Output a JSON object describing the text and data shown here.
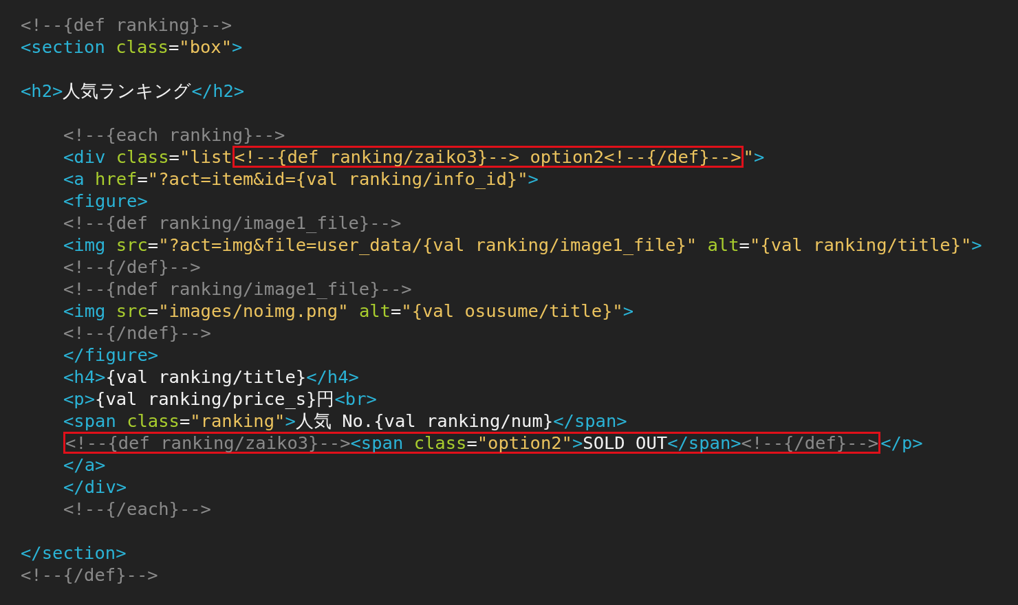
{
  "editor": {
    "sections": [
      {
        "lines": [
          {
            "parts": [
              {
                "boxed": false,
                "tokens": [
                  {
                    "kind": "comment",
                    "text": "<!--{def ranking}-->"
                  }
                ]
              }
            ]
          },
          {
            "parts": [
              {
                "boxed": false,
                "tokens": [
                  {
                    "kind": "tag",
                    "text": "<section "
                  },
                  {
                    "kind": "attr",
                    "text": "class"
                  },
                  {
                    "kind": "plain",
                    "text": "="
                  },
                  {
                    "kind": "string",
                    "text": "\"box\""
                  },
                  {
                    "kind": "tag",
                    "text": ">"
                  }
                ]
              }
            ]
          }
        ]
      },
      {
        "lines": [
          {
            "parts": [
              {
                "boxed": false,
                "tokens": [
                  {
                    "kind": "tag",
                    "text": "<h2>"
                  },
                  {
                    "kind": "plain",
                    "text": "人気ランキング"
                  },
                  {
                    "kind": "tag",
                    "text": "</h2>"
                  }
                ]
              }
            ]
          }
        ],
        "children": [
          {
            "lines": [
              {
                "parts": [
                  {
                    "boxed": false,
                    "tokens": [
                      {
                        "kind": "comment",
                        "text": "<!--{each ranking}-->"
                      }
                    ]
                  }
                ]
              },
              {
                "parts": [
                  {
                    "boxed": false,
                    "tokens": [
                      {
                        "kind": "tag",
                        "text": "<div "
                      },
                      {
                        "kind": "attr",
                        "text": "class"
                      },
                      {
                        "kind": "plain",
                        "text": "="
                      },
                      {
                        "kind": "string",
                        "text": "\"list"
                      }
                    ]
                  },
                  {
                    "boxed": true,
                    "tokens": [
                      {
                        "kind": "string",
                        "text": "<!--{def ranking/zaiko3}--> option2<!--{/def}-->"
                      }
                    ]
                  },
                  {
                    "boxed": false,
                    "tokens": [
                      {
                        "kind": "string",
                        "text": "\""
                      },
                      {
                        "kind": "tag",
                        "text": ">"
                      }
                    ]
                  }
                ]
              },
              {
                "parts": [
                  {
                    "boxed": false,
                    "tokens": [
                      {
                        "kind": "tag",
                        "text": "<a "
                      },
                      {
                        "kind": "attr",
                        "text": "href"
                      },
                      {
                        "kind": "plain",
                        "text": "="
                      },
                      {
                        "kind": "string",
                        "text": "\"?act=item&id={val ranking/info_id}\""
                      },
                      {
                        "kind": "tag",
                        "text": ">"
                      }
                    ]
                  }
                ]
              },
              {
                "parts": [
                  {
                    "boxed": false,
                    "tokens": [
                      {
                        "kind": "tag",
                        "text": "<figure>"
                      }
                    ]
                  }
                ]
              },
              {
                "parts": [
                  {
                    "boxed": false,
                    "tokens": [
                      {
                        "kind": "comment",
                        "text": "<!--{def ranking/image1_file}-->"
                      }
                    ]
                  }
                ]
              },
              {
                "parts": [
                  {
                    "boxed": false,
                    "tokens": [
                      {
                        "kind": "tag",
                        "text": "<img "
                      },
                      {
                        "kind": "attr",
                        "text": "src"
                      },
                      {
                        "kind": "plain",
                        "text": "="
                      },
                      {
                        "kind": "string",
                        "text": "\"?act=img&file=user_data/{val ranking/image1_file}\" "
                      },
                      {
                        "kind": "attr",
                        "text": "alt"
                      },
                      {
                        "kind": "plain",
                        "text": "="
                      },
                      {
                        "kind": "string",
                        "text": "\"{val ranking/title}\""
                      },
                      {
                        "kind": "tag",
                        "text": ">"
                      }
                    ]
                  }
                ]
              },
              {
                "parts": [
                  {
                    "boxed": false,
                    "tokens": [
                      {
                        "kind": "comment",
                        "text": "<!--{/def}-->"
                      }
                    ]
                  }
                ]
              },
              {
                "parts": [
                  {
                    "boxed": false,
                    "tokens": [
                      {
                        "kind": "comment",
                        "text": "<!--{ndef ranking/image1_file}-->"
                      }
                    ]
                  }
                ]
              },
              {
                "parts": [
                  {
                    "boxed": false,
                    "tokens": [
                      {
                        "kind": "tag",
                        "text": "<img "
                      },
                      {
                        "kind": "attr",
                        "text": "src"
                      },
                      {
                        "kind": "plain",
                        "text": "="
                      },
                      {
                        "kind": "string",
                        "text": "\"images/noimg.png\" "
                      },
                      {
                        "kind": "attr",
                        "text": "alt"
                      },
                      {
                        "kind": "plain",
                        "text": "="
                      },
                      {
                        "kind": "string",
                        "text": "\"{val osusume/title}\""
                      },
                      {
                        "kind": "tag",
                        "text": ">"
                      }
                    ]
                  }
                ]
              },
              {
                "parts": [
                  {
                    "boxed": false,
                    "tokens": [
                      {
                        "kind": "comment",
                        "text": "<!--{/ndef}-->"
                      }
                    ]
                  }
                ]
              },
              {
                "parts": [
                  {
                    "boxed": false,
                    "tokens": [
                      {
                        "kind": "tag",
                        "text": "</figure>"
                      }
                    ]
                  }
                ]
              },
              {
                "parts": [
                  {
                    "boxed": false,
                    "tokens": [
                      {
                        "kind": "tag",
                        "text": "<h4>"
                      },
                      {
                        "kind": "plain",
                        "text": "{val ranking/title}"
                      },
                      {
                        "kind": "tag",
                        "text": "</h4>"
                      }
                    ]
                  }
                ]
              },
              {
                "parts": [
                  {
                    "boxed": false,
                    "tokens": [
                      {
                        "kind": "tag",
                        "text": "<p>"
                      },
                      {
                        "kind": "plain",
                        "text": "{val ranking/price_s}円"
                      },
                      {
                        "kind": "tag",
                        "text": "<br>"
                      }
                    ]
                  }
                ]
              },
              {
                "parts": [
                  {
                    "boxed": false,
                    "tokens": [
                      {
                        "kind": "tag",
                        "text": "<span "
                      },
                      {
                        "kind": "attr",
                        "text": "class"
                      },
                      {
                        "kind": "plain",
                        "text": "="
                      },
                      {
                        "kind": "string",
                        "text": "\"ranking\""
                      },
                      {
                        "kind": "tag",
                        "text": ">"
                      },
                      {
                        "kind": "plain",
                        "text": "人気 No.{val ranking/num}"
                      },
                      {
                        "kind": "tag",
                        "text": "</span>"
                      }
                    ]
                  }
                ]
              },
              {
                "parts": [
                  {
                    "boxed": true,
                    "tokens": [
                      {
                        "kind": "comment",
                        "text": "<!--{def ranking/zaiko3}-->"
                      },
                      {
                        "kind": "tag",
                        "text": "<span "
                      },
                      {
                        "kind": "attr",
                        "text": "class"
                      },
                      {
                        "kind": "plain",
                        "text": "="
                      },
                      {
                        "kind": "string",
                        "text": "\"option2\""
                      },
                      {
                        "kind": "tag",
                        "text": ">"
                      },
                      {
                        "kind": "plain",
                        "text": "SOLD OUT"
                      },
                      {
                        "kind": "tag",
                        "text": "</span>"
                      },
                      {
                        "kind": "comment",
                        "text": "<!--{/def}-->"
                      }
                    ]
                  },
                  {
                    "boxed": false,
                    "tokens": [
                      {
                        "kind": "tag",
                        "text": "</p>"
                      }
                    ]
                  }
                ]
              },
              {
                "parts": [
                  {
                    "boxed": false,
                    "tokens": [
                      {
                        "kind": "tag",
                        "text": "</a>"
                      }
                    ]
                  }
                ]
              },
              {
                "parts": [
                  {
                    "boxed": false,
                    "tokens": [
                      {
                        "kind": "tag",
                        "text": "</div>"
                      }
                    ]
                  }
                ]
              },
              {
                "parts": [
                  {
                    "boxed": false,
                    "tokens": [
                      {
                        "kind": "comment",
                        "text": "<!--{/each}-->"
                      }
                    ]
                  }
                ]
              }
            ]
          }
        ]
      },
      {
        "lines": [
          {
            "parts": [
              {
                "boxed": false,
                "tokens": [
                  {
                    "kind": "tag",
                    "text": "</section>"
                  }
                ]
              }
            ]
          },
          {
            "parts": [
              {
                "boxed": false,
                "tokens": [
                  {
                    "kind": "comment",
                    "text": "<!--{/def}-->"
                  }
                ]
              }
            ]
          }
        ]
      }
    ]
  }
}
